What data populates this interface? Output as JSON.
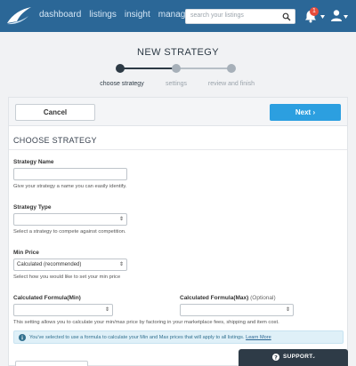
{
  "nav": {
    "links": [
      "dashboard",
      "listings",
      "insight",
      "manage"
    ],
    "search_placeholder": "search your listings",
    "notification_count": "1"
  },
  "header": {
    "title": "NEW STRATEGY",
    "steps": [
      {
        "label": "choose strategy",
        "active": true
      },
      {
        "label": "settings",
        "active": false
      },
      {
        "label": "review and finish",
        "active": false
      }
    ]
  },
  "actions": {
    "cancel_label": "Cancel",
    "next_label": "Next ›"
  },
  "form": {
    "section_title": "CHOOSE STRATEGY",
    "strategy_name": {
      "label": "Strategy Name",
      "value": "",
      "help": "Give your strategy a name you can easily identify."
    },
    "strategy_type": {
      "label": "Strategy Type",
      "value": "",
      "help": "Select a strategy to compete against competition."
    },
    "min_price": {
      "label": "Min Price",
      "value": "Calculated (recommended)",
      "help": "Select how you would like to set your min price"
    },
    "formula_min": {
      "label": "Calculated Formula(Min)",
      "value": ""
    },
    "formula_max": {
      "label": "Calculated Formula(Max)",
      "optional": "(Optional)",
      "value": ""
    },
    "formula_help": "This setting allows you to calculate your min/max price by factoring in your marketplace fees, shipping and item cost.",
    "info": {
      "text": "You've selected to use a formula to calculate your Min and Max prices that will apply to all listings.",
      "link": "Learn More"
    }
  },
  "support": {
    "label": "SUPPORT"
  },
  "colors": {
    "nav_bg": "#2b6797",
    "primary": "#2c9fe0",
    "step_active": "#2d3a45",
    "step_inactive": "#a7b0b9"
  }
}
